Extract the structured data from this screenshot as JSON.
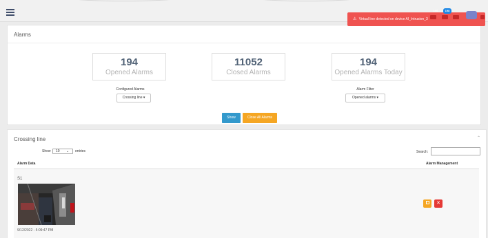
{
  "header": {
    "notifications": [
      {
        "count": "196",
        "color": "#e53935"
      },
      {
        "count": "198",
        "color": "#1e88e5"
      }
    ],
    "nav_icons": [
      {
        "icon": "envelope-icon",
        "color": "#c62828"
      },
      {
        "icon": "bell-icon",
        "color": "#c62828"
      },
      {
        "icon": "grid-icon",
        "color": "#c62828"
      },
      {
        "icon": "user-icon",
        "color": "#c62828"
      }
    ]
  },
  "toast": {
    "icon": "warning-icon",
    "message": "Virtual line detected on device AI_Intrusion_3"
  },
  "alarms_panel": {
    "title": "Alarms",
    "stats": [
      {
        "value": "194",
        "label": "Opened Alarms"
      },
      {
        "value": "11052",
        "label": "Closed Alarms"
      },
      {
        "value": "194",
        "label": "Opened Alarms Today"
      }
    ],
    "configured": {
      "label": "Configured Alarms",
      "value": "Crossing line"
    },
    "filter": {
      "label": "Alarm Filter",
      "value": "Opened alarms"
    },
    "show_button": "Show",
    "close_all_button": "Close All Alarms"
  },
  "crossing_panel": {
    "title": "Crossing line",
    "show_label": "Show",
    "entries_value": "10",
    "entries_label": "entries",
    "search_label": "Search:",
    "columns": [
      "Alarm Data",
      "Alarm Management"
    ],
    "rows": [
      {
        "id": "S1",
        "timestamp": "9/12/2022 - 5:09:47 PM"
      }
    ],
    "actions": [
      {
        "icon": "stop-icon",
        "color": "#f5a623"
      },
      {
        "icon": "close-icon",
        "color": "#e53935"
      }
    ]
  }
}
